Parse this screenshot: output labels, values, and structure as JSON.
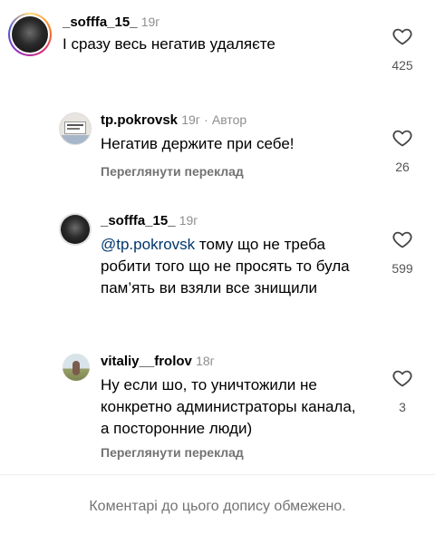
{
  "comments": [
    {
      "username": "_sofffa_15_",
      "time": "19г",
      "author_tag": "",
      "text": "І сразу весь негатив удаляєте",
      "likes": "425",
      "translate": ""
    },
    {
      "username": "tp.pokrovsk",
      "time": "19г",
      "author_tag": "Автор",
      "text": "Негатив держите при себе!",
      "likes": "26",
      "translate": "Переглянути переклад"
    },
    {
      "username": "_sofffa_15_",
      "time": "19г",
      "author_tag": "",
      "mention": "@tp.pokrovsk",
      "text": " тому що не треба робити того що не просять то була пам’ять ви взяли все знищили",
      "likes": "599",
      "translate": ""
    },
    {
      "username": "vitaliy__frolov",
      "time": "18г",
      "author_tag": "",
      "text": "Ну если шо, то уничтожили не конкретно администраторы канала, а посторонние люди)",
      "likes": "3",
      "translate": "Переглянути переклад"
    }
  ],
  "footer": {
    "notice": "Коментарі до цього допису обмежено."
  },
  "separator": "·"
}
